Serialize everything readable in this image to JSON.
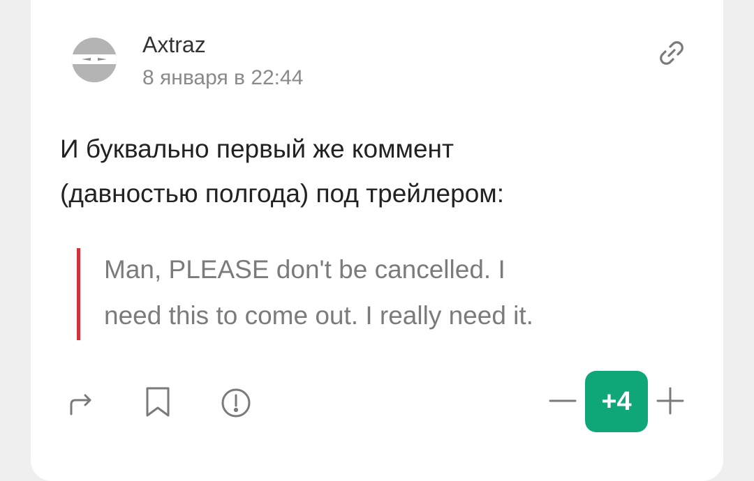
{
  "post": {
    "author": "Axtraz",
    "date": "8 января в 22:44",
    "body_lines": [
      "И буквально первый же коммент",
      "(давностью полгода) под трейлером:"
    ],
    "quote_lines": [
      "Man, PLEASE don't be cancelled. I",
      "need this to come out. I really need it."
    ],
    "score": "+4"
  },
  "colors": {
    "background": "#efefef",
    "card": "#ffffff",
    "quote_border": "#d4313b",
    "score_badge": "#0fa678",
    "icon": "#7a7a7a"
  },
  "icons": {
    "avatar": "ninja-avatar",
    "link": "link-icon",
    "share": "share-arrow-icon",
    "bookmark": "bookmark-icon",
    "report": "exclamation-circle-icon",
    "minus": "minus-icon",
    "plus": "plus-icon"
  }
}
